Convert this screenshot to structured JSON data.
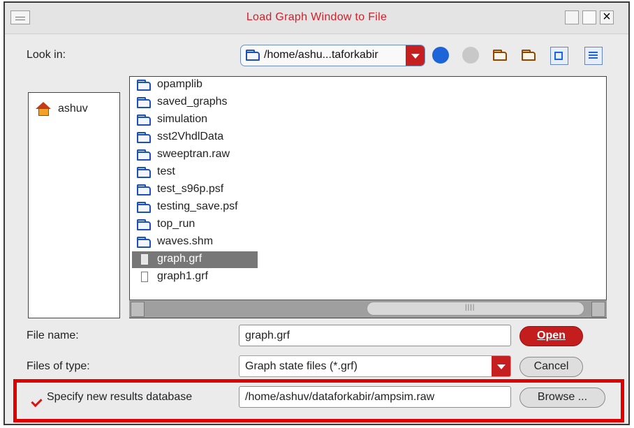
{
  "window": {
    "title": "Load Graph Window to File"
  },
  "look_in": {
    "label": "Look in:",
    "path": "/home/ashu...taforkabir"
  },
  "places": [
    {
      "label": "ashuv"
    }
  ],
  "files": [
    {
      "name": "opamplib",
      "type": "folder"
    },
    {
      "name": "saved_graphs",
      "type": "folder"
    },
    {
      "name": "simulation",
      "type": "folder"
    },
    {
      "name": "sst2VhdlData",
      "type": "folder"
    },
    {
      "name": "sweeptran.raw",
      "type": "folder"
    },
    {
      "name": "test",
      "type": "folder"
    },
    {
      "name": "test_s96p.psf",
      "type": "folder"
    },
    {
      "name": "testing_save.psf",
      "type": "folder"
    },
    {
      "name": "top_run",
      "type": "folder"
    },
    {
      "name": "waves.shm",
      "type": "folder"
    },
    {
      "name": "graph.grf",
      "type": "file",
      "selected": true
    },
    {
      "name": "graph1.grf",
      "type": "file"
    }
  ],
  "file_name": {
    "label": "File name:",
    "value": "graph.grf"
  },
  "files_of_type": {
    "label": "Files of type:",
    "value": "Graph state files (*.grf)"
  },
  "results_db": {
    "label": "Specify new results database",
    "value": "/home/ashuv/dataforkabir/ampsim.raw",
    "checked": true
  },
  "buttons": {
    "open": "Open",
    "cancel": "Cancel",
    "browse": "Browse ..."
  },
  "colors": {
    "accent": "#c41d1d",
    "selection": "#777777",
    "highlight": "#e00000"
  },
  "icons": {
    "home": "home-icon",
    "folder": "folder-icon",
    "document": "document-icon"
  }
}
